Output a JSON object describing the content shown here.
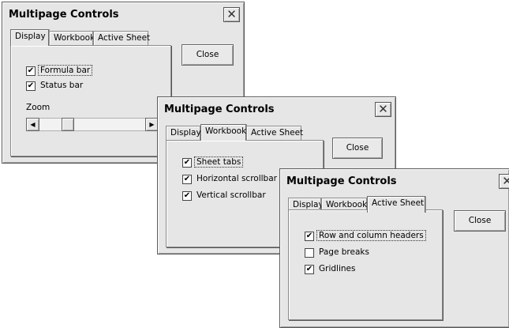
{
  "dialogs": [
    {
      "title": "Multipage Controls",
      "close_glyph": "✕",
      "close_icon": "close-icon",
      "tabs": [
        "Display",
        "Workbook",
        "Active Sheet"
      ],
      "active_tab": "Display",
      "button": "Close",
      "checkboxes": [
        {
          "label": "Formula bar",
          "checked": true,
          "mark": "✔"
        },
        {
          "label": "Status bar",
          "checked": true,
          "mark": "✔"
        }
      ],
      "zoom": {
        "label": "Zoom",
        "left_arrow": "◀",
        "right_arrow": "▶",
        "value_fraction": 0.15
      }
    },
    {
      "title": "Multipage Controls",
      "close_glyph": "✕",
      "close_icon": "close-icon",
      "tabs": [
        "Display",
        "Workbook",
        "Active Sheet"
      ],
      "active_tab": "Workbook",
      "button": "Close",
      "checkboxes": [
        {
          "label": "Sheet tabs",
          "checked": true,
          "mark": "✔"
        },
        {
          "label": "Horizontal scrollbar",
          "checked": true,
          "mark": "✔"
        },
        {
          "label": "Vertical scrollbar",
          "checked": true,
          "mark": "✔"
        }
      ]
    },
    {
      "title": "Multipage Controls",
      "close_glyph": "✕",
      "close_icon": "close-icon",
      "tabs": [
        "Display",
        "Workbook",
        "Active Sheet"
      ],
      "active_tab": "Active Sheet",
      "button": "Close",
      "checkboxes": [
        {
          "label": "Row and column headers",
          "checked": true,
          "mark": "✔"
        },
        {
          "label": "Page breaks",
          "checked": false,
          "mark": ""
        },
        {
          "label": "Gridlines",
          "checked": true,
          "mark": "✔"
        }
      ]
    }
  ]
}
